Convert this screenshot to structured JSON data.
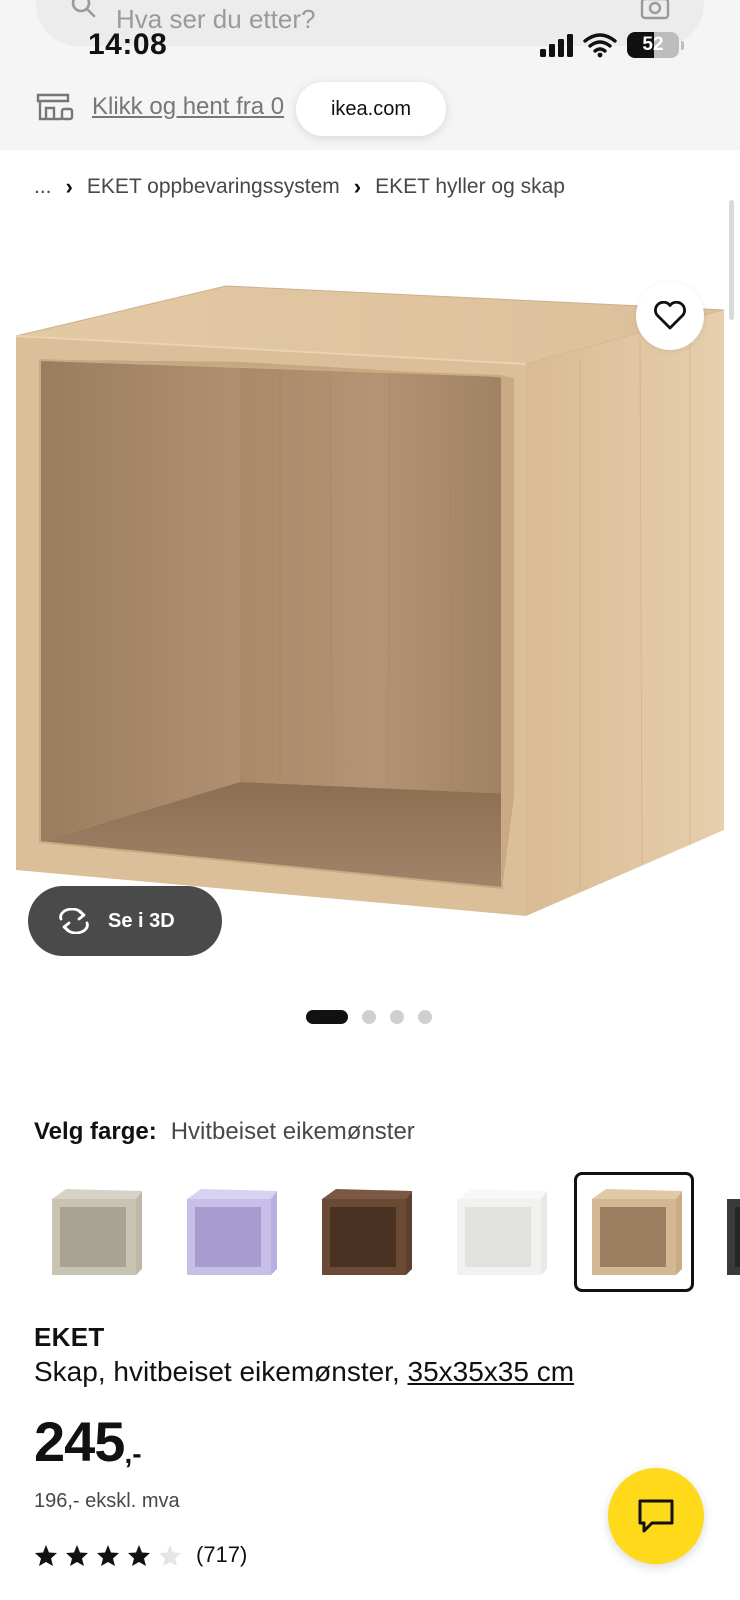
{
  "status_bar": {
    "time": "14:08",
    "battery_level": "52"
  },
  "search": {
    "placeholder": "Hva ser du etter?"
  },
  "pickup": {
    "label": "Klikk og hent fra 0"
  },
  "browser": {
    "url": "ikea.com"
  },
  "breadcrumb": {
    "ellipsis": "...",
    "items": [
      "EKET oppbevaringssystem",
      "EKET hyller og skap"
    ]
  },
  "gallery": {
    "total_images": 4,
    "active_index": 1
  },
  "view_3d": {
    "label": "Se i 3D"
  },
  "color": {
    "label": "Velg farge:",
    "selected": "Hvitbeiset eikemønster",
    "swatches": [
      {
        "name": "beige-grey",
        "color": "#c9c3b4"
      },
      {
        "name": "lilac",
        "color": "#c7bfe8"
      },
      {
        "name": "walnut",
        "color": "#6a4a35"
      },
      {
        "name": "white",
        "color": "#f1f1ef"
      },
      {
        "name": "white-stained-oak",
        "color": "#d4b893",
        "selected": true
      },
      {
        "name": "dark-grey",
        "color": "#3a3a3a"
      }
    ]
  },
  "product": {
    "name": "EKET",
    "description": "Skap, hvitbeiset eikemønster,",
    "size": "35x35x35 cm",
    "price": "245",
    "price_suffix": ",-",
    "price_ex_vat": "196,- ekskl. mva",
    "rating": {
      "stars": 4,
      "max": 5,
      "count": "(717)"
    }
  },
  "colors": {
    "chat_button": "#ffda1a",
    "btn_3d": "#4a4a4a",
    "wood": "#d4b893"
  }
}
